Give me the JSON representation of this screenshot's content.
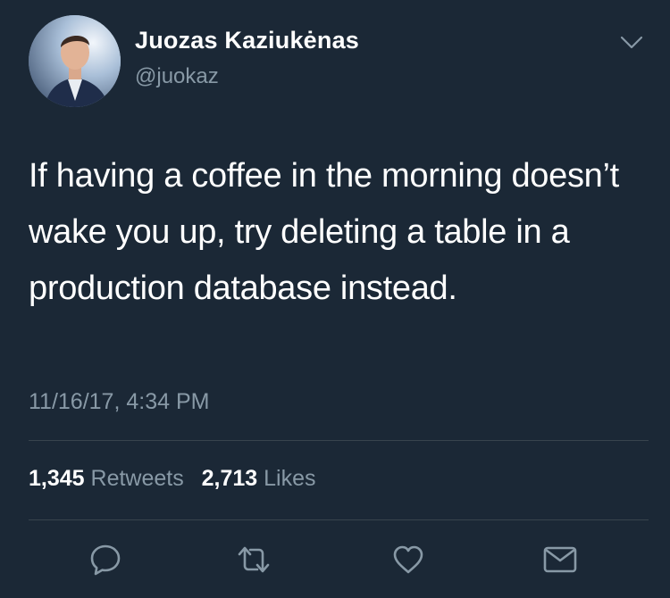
{
  "tweet": {
    "author_name": "Juozas Kaziukėnas",
    "author_handle": "@juokaz",
    "text": "If having a coffee in the morning doesn’t wake you up, try deleting a table in a production database instead.",
    "timestamp": "11/16/17, 4:34 PM",
    "retweet_count": "1,345",
    "retweet_label": "Retweets",
    "like_count": "2,713",
    "like_label": "Likes"
  },
  "actions": {
    "reply_icon": "reply-icon",
    "retweet_icon": "retweet-icon",
    "like_icon": "heart-icon",
    "message_icon": "envelope-icon",
    "menu_icon": "chevron-down-icon"
  },
  "colors": {
    "background": "#1b2836",
    "text_primary": "#ffffff",
    "text_secondary": "#8899a6",
    "divider": "#38444d"
  }
}
